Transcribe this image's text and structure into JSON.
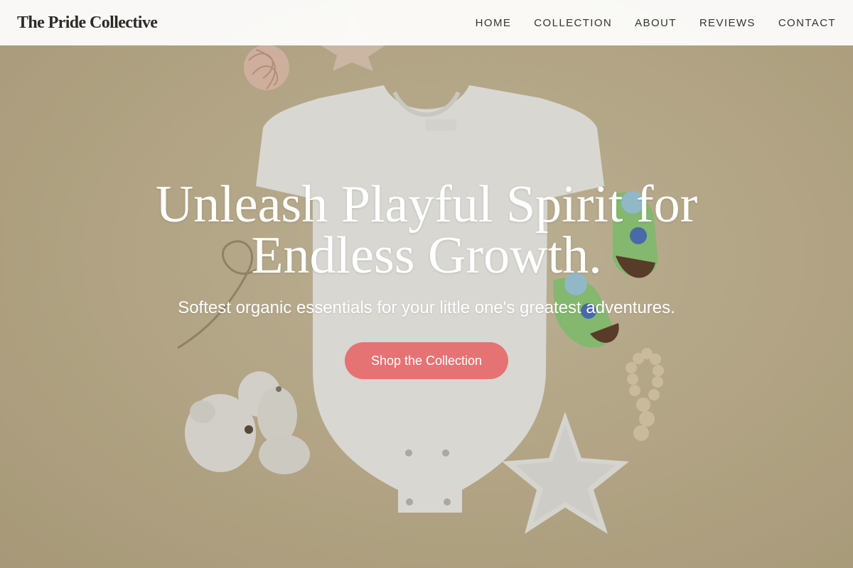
{
  "brand": {
    "name": "The Pride Collective"
  },
  "nav": {
    "items": [
      {
        "label": "HOME"
      },
      {
        "label": "COLLECTION"
      },
      {
        "label": "ABOUT"
      },
      {
        "label": "REVIEWS"
      },
      {
        "label": "CONTACT"
      }
    ]
  },
  "hero": {
    "headline": "Unleash Playful Spirit for Endless Growth.",
    "subheadline": "Softest organic essentials for your little one's greatest adventures.",
    "cta_label": "Shop the Collection",
    "image_items": [
      "onesie-image",
      "teddy-bear-image",
      "star-pillow-image",
      "baby-socks-image",
      "wooden-bead-rattle-image",
      "rattan-ball-image"
    ]
  },
  "colors": {
    "accent": "#e57373",
    "background": "#c8b998",
    "header_bg": "#ffffff",
    "text_dark": "#2d2a26"
  }
}
